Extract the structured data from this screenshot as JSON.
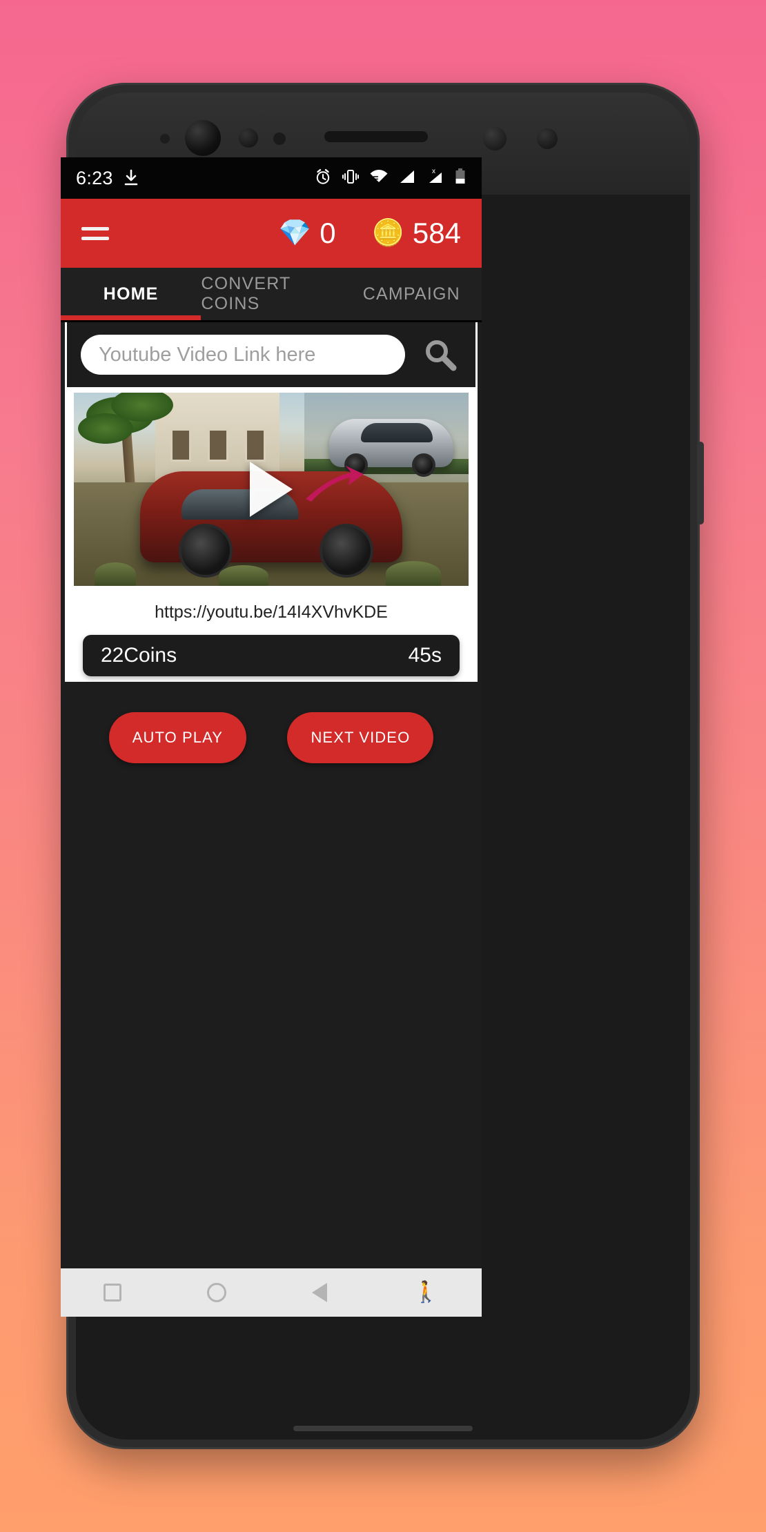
{
  "status_bar": {
    "time": "6:23",
    "download_icon": "download-icon",
    "icons": [
      "alarm-icon",
      "vibrate-icon",
      "wifi-icon",
      "signal-icon",
      "signal-no-sim-icon",
      "battery-low-icon"
    ]
  },
  "app_bar": {
    "menu_icon": "hamburger-menu-icon",
    "diamond_icon": "💎",
    "diamond_value": "0",
    "coins_icon": "🪙",
    "coins_value": "584",
    "background_color": "#d32a2a"
  },
  "tabs": [
    {
      "label": "HOME",
      "active": true
    },
    {
      "label": "CONVERT COINS",
      "active": false
    },
    {
      "label": "CAMPAIGN",
      "active": false
    }
  ],
  "search": {
    "placeholder": "Youtube Video Link here",
    "value": "",
    "search_icon": "search-icon"
  },
  "video": {
    "play_icon": "play-icon",
    "url": "https://youtu.be/14I4XVhvKDE",
    "coins_label": "22Coins",
    "duration_label": "45s"
  },
  "actions": {
    "auto_play": "AUTO PLAY",
    "next_video": "NEXT VIDEO"
  },
  "nav_bar": {
    "recents": "recents-square-icon",
    "home": "home-circle-icon",
    "back": "back-triangle-icon",
    "accessibility": "accessibility-icon"
  }
}
